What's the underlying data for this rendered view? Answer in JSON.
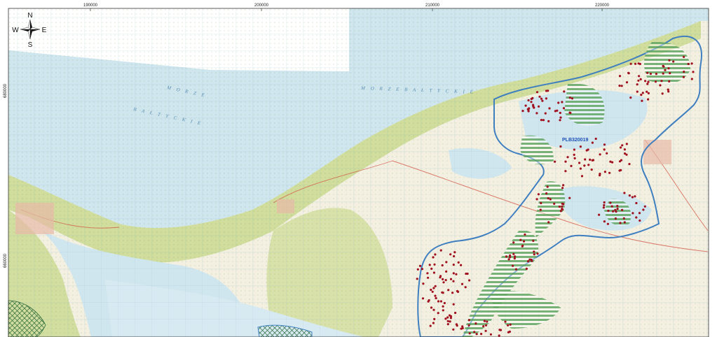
{
  "map": {
    "x_ticks": [
      "190000",
      "200000",
      "210000",
      "220000"
    ],
    "y_ticks": [
      "680000",
      "660000"
    ],
    "compass": {
      "n": "N",
      "s": "S",
      "e": "E",
      "w": "W"
    },
    "sea_labels": [
      "M O R Z E",
      "B A Ł T Y C K I E",
      "M O R Z E   B A Ł T Y C K I E"
    ],
    "site_code": "PLB320019",
    "colors": {
      "sea": "#cfe6ef",
      "land": "#f3f0e2",
      "forest": "#c9d98f",
      "boundary": "#3f7fc0",
      "site_points": "#a0101e",
      "hatch": "#3f8f4a"
    }
  }
}
